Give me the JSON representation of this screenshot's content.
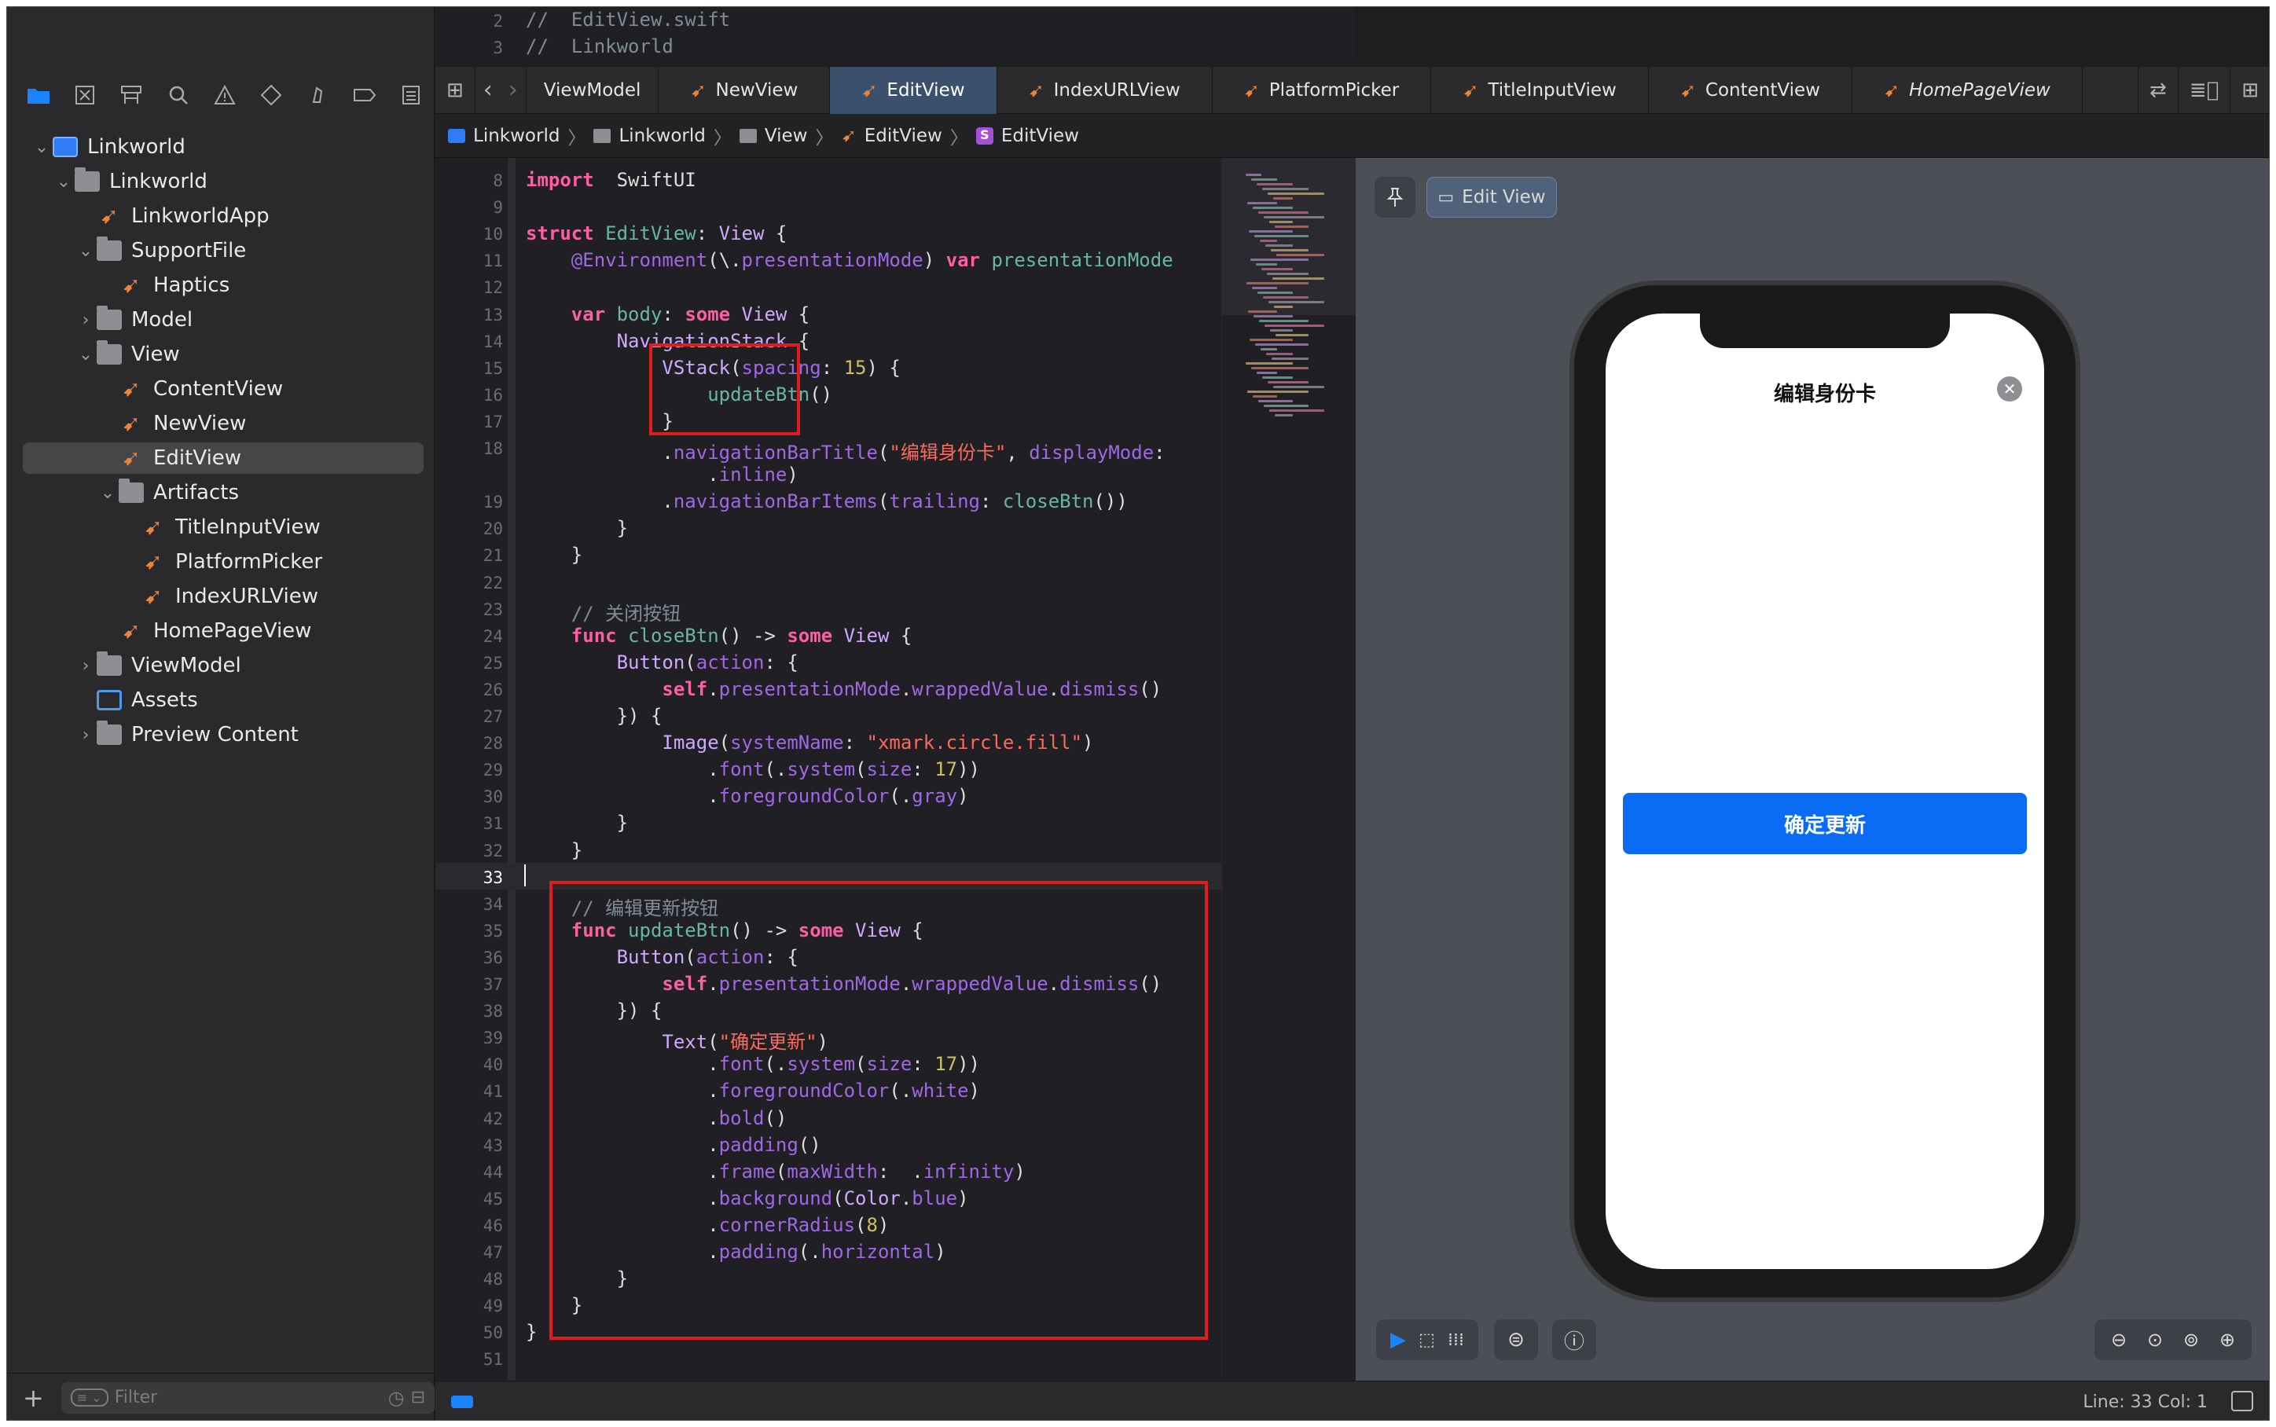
{
  "sidebar": {
    "tree": [
      {
        "label": "Linkworld",
        "icon": "project-icon",
        "indent": 0,
        "chevron": "expanded"
      },
      {
        "label": "Linkworld",
        "icon": "folder-icon",
        "indent": 1,
        "chevron": "expanded"
      },
      {
        "label": "LinkworldApp",
        "icon": "swift-icon",
        "indent": 2,
        "chevron": "none"
      },
      {
        "label": "SupportFile",
        "icon": "folder-icon",
        "indent": 2,
        "chevron": "expanded"
      },
      {
        "label": "Haptics",
        "icon": "swift-icon",
        "indent": 3,
        "chevron": "none"
      },
      {
        "label": "Model",
        "icon": "folder-icon",
        "indent": 2,
        "chevron": "collapsed"
      },
      {
        "label": "View",
        "icon": "folder-icon",
        "indent": 2,
        "chevron": "expanded"
      },
      {
        "label": "ContentView",
        "icon": "swift-icon",
        "indent": 3,
        "chevron": "none"
      },
      {
        "label": "NewView",
        "icon": "swift-icon",
        "indent": 3,
        "chevron": "none"
      },
      {
        "label": "EditView",
        "icon": "swift-icon",
        "indent": 3,
        "chevron": "none",
        "selected": true
      },
      {
        "label": "Artifacts",
        "icon": "folder-icon",
        "indent": 3,
        "chevron": "expanded"
      },
      {
        "label": "TitleInputView",
        "icon": "swift-icon",
        "indent": 4,
        "chevron": "none"
      },
      {
        "label": "PlatformPicker",
        "icon": "swift-icon",
        "indent": 4,
        "chevron": "none"
      },
      {
        "label": "IndexURLView",
        "icon": "swift-icon",
        "indent": 4,
        "chevron": "none"
      },
      {
        "label": "HomePageView",
        "icon": "swift-icon",
        "indent": 3,
        "chevron": "none"
      },
      {
        "label": "ViewModel",
        "icon": "folder-icon",
        "indent": 2,
        "chevron": "collapsed"
      },
      {
        "label": "Assets",
        "icon": "assets-icon",
        "indent": 2,
        "chevron": "none"
      },
      {
        "label": "Preview Content",
        "icon": "folder-icon",
        "indent": 2,
        "chevron": "collapsed"
      }
    ],
    "filter_placeholder": "Filter"
  },
  "top_code": [
    {
      "n": "2",
      "text": "//  EditView.swift"
    },
    {
      "n": "3",
      "text": "//  Linkworld"
    }
  ],
  "tabs": [
    {
      "label": "ViewModel",
      "swift": false
    },
    {
      "label": "NewView",
      "swift": true
    },
    {
      "label": "EditView",
      "swift": true,
      "active": true
    },
    {
      "label": "IndexURLView",
      "swift": true
    },
    {
      "label": "PlatformPicker",
      "swift": true
    },
    {
      "label": "TitleInputView",
      "swift": true
    },
    {
      "label": "ContentView",
      "swift": true
    },
    {
      "label": "HomePageView",
      "swift": true,
      "italic": true
    }
  ],
  "breadcrumbs": [
    "Linkworld",
    "Linkworld",
    "View",
    "EditView",
    "EditView"
  ],
  "code": [
    {
      "n": "8",
      "t": [
        [
          "kw",
          "import"
        ],
        [
          "",
          "  SwiftUI"
        ]
      ]
    },
    {
      "n": "9",
      "t": []
    },
    {
      "n": "10",
      "t": [
        [
          "kw",
          "struct"
        ],
        [
          "fn",
          " EditView"
        ],
        [
          "",
          ": "
        ],
        [
          "ty",
          "View"
        ],
        [
          "",
          " {"
        ]
      ]
    },
    {
      "n": "11",
      "t": [
        [
          "",
          "    "
        ],
        [
          "at",
          "@Environment"
        ],
        [
          "",
          "(\\."
        ],
        [
          "pr",
          "presentationMode"
        ],
        [
          "",
          ") "
        ],
        [
          "kw",
          "var"
        ],
        [
          "fn",
          " presentationMode"
        ]
      ]
    },
    {
      "n": "12",
      "t": []
    },
    {
      "n": "13",
      "t": [
        [
          "",
          "    "
        ],
        [
          "kw",
          "var"
        ],
        [
          "fn",
          " body"
        ],
        [
          "",
          ": "
        ],
        [
          "kw",
          "some"
        ],
        [
          "ty",
          " View"
        ],
        [
          "",
          " {"
        ]
      ]
    },
    {
      "n": "14",
      "t": [
        [
          "",
          "        "
        ],
        [
          "ty",
          "NavigationStack"
        ],
        [
          "",
          " {"
        ]
      ]
    },
    {
      "n": "15",
      "t": [
        [
          "",
          "            "
        ],
        [
          "ty",
          "VStack"
        ],
        [
          "",
          "("
        ],
        [
          "pr",
          "spacing"
        ],
        [
          "",
          ": "
        ],
        [
          "nu",
          "15"
        ],
        [
          "",
          ") {"
        ]
      ]
    },
    {
      "n": "16",
      "t": [
        [
          "",
          "                "
        ],
        [
          "fn",
          "updateBtn"
        ],
        [
          "",
          "()"
        ]
      ]
    },
    {
      "n": "17",
      "t": [
        [
          "",
          "            }"
        ]
      ]
    },
    {
      "n": "18",
      "t": [
        [
          "",
          "            ."
        ],
        [
          "pr",
          "navigationBarTitle"
        ],
        [
          "",
          "("
        ],
        [
          "st",
          "\"编辑身份卡\""
        ],
        [
          "",
          ", "
        ],
        [
          "pr",
          "displayMode"
        ],
        [
          "",
          ":"
        ]
      ]
    },
    {
      "n": "",
      "t": [
        [
          "",
          "                ."
        ],
        [
          "pr",
          "inline"
        ],
        [
          "",
          ")"
        ]
      ]
    },
    {
      "n": "19",
      "t": [
        [
          "",
          "            ."
        ],
        [
          "pr",
          "navigationBarItems"
        ],
        [
          "",
          "("
        ],
        [
          "pr",
          "trailing"
        ],
        [
          "",
          ": "
        ],
        [
          "fn",
          "closeBtn"
        ],
        [
          "",
          "())"
        ]
      ]
    },
    {
      "n": "20",
      "t": [
        [
          "",
          "        }"
        ]
      ]
    },
    {
      "n": "21",
      "t": [
        [
          "",
          "    }"
        ]
      ]
    },
    {
      "n": "22",
      "t": []
    },
    {
      "n": "23",
      "t": [
        [
          "cm",
          "    // 关闭按钮"
        ]
      ]
    },
    {
      "n": "24",
      "t": [
        [
          "",
          "    "
        ],
        [
          "kw",
          "func"
        ],
        [
          "fn",
          " closeBtn"
        ],
        [
          "",
          "() -> "
        ],
        [
          "kw",
          "some"
        ],
        [
          "ty",
          " View"
        ],
        [
          "",
          " {"
        ]
      ]
    },
    {
      "n": "25",
      "t": [
        [
          "",
          "        "
        ],
        [
          "ty",
          "Button"
        ],
        [
          "",
          "("
        ],
        [
          "pr",
          "action"
        ],
        [
          "",
          ": {"
        ]
      ]
    },
    {
      "n": "26",
      "t": [
        [
          "",
          "            "
        ],
        [
          "kw",
          "self"
        ],
        [
          "",
          "."
        ],
        [
          "pr",
          "presentationMode"
        ],
        [
          "",
          "."
        ],
        [
          "pr",
          "wrappedValue"
        ],
        [
          "",
          "."
        ],
        [
          "pr",
          "dismiss"
        ],
        [
          "",
          "()"
        ]
      ]
    },
    {
      "n": "27",
      "t": [
        [
          "",
          "        }) {"
        ]
      ]
    },
    {
      "n": "28",
      "t": [
        [
          "",
          "            "
        ],
        [
          "ty",
          "Image"
        ],
        [
          "",
          "("
        ],
        [
          "pr",
          "systemName"
        ],
        [
          "",
          ": "
        ],
        [
          "st",
          "\"xmark.circle.fill\""
        ],
        [
          "",
          ")"
        ]
      ]
    },
    {
      "n": "29",
      "t": [
        [
          "",
          "                ."
        ],
        [
          "pr",
          "font"
        ],
        [
          "",
          "(."
        ],
        [
          "pr",
          "system"
        ],
        [
          "",
          "("
        ],
        [
          "pr",
          "size"
        ],
        [
          "",
          ": "
        ],
        [
          "nu",
          "17"
        ],
        [
          "",
          "))"
        ]
      ]
    },
    {
      "n": "30",
      "t": [
        [
          "",
          "                ."
        ],
        [
          "pr",
          "foregroundColor"
        ],
        [
          "",
          "(."
        ],
        [
          "pr",
          "gray"
        ],
        [
          "",
          ")"
        ]
      ]
    },
    {
      "n": "31",
      "t": [
        [
          "",
          "        }"
        ]
      ]
    },
    {
      "n": "32",
      "t": [
        [
          "",
          "    }"
        ]
      ]
    },
    {
      "n": "33",
      "t": [],
      "current": true
    },
    {
      "n": "34",
      "t": [
        [
          "cm",
          "    // 编辑更新按钮"
        ]
      ]
    },
    {
      "n": "35",
      "t": [
        [
          "",
          "    "
        ],
        [
          "kw",
          "func"
        ],
        [
          "fn",
          " updateBtn"
        ],
        [
          "",
          "() -> "
        ],
        [
          "kw",
          "some"
        ],
        [
          "ty",
          " View"
        ],
        [
          "",
          " {"
        ]
      ]
    },
    {
      "n": "36",
      "t": [
        [
          "",
          "        "
        ],
        [
          "ty",
          "Button"
        ],
        [
          "",
          "("
        ],
        [
          "pr",
          "action"
        ],
        [
          "",
          ": {"
        ]
      ]
    },
    {
      "n": "37",
      "t": [
        [
          "",
          "            "
        ],
        [
          "kw",
          "self"
        ],
        [
          "",
          "."
        ],
        [
          "pr",
          "presentationMode"
        ],
        [
          "",
          "."
        ],
        [
          "pr",
          "wrappedValue"
        ],
        [
          "",
          "."
        ],
        [
          "pr",
          "dismiss"
        ],
        [
          "",
          "()"
        ]
      ]
    },
    {
      "n": "38",
      "t": [
        [
          "",
          "        }) {"
        ]
      ]
    },
    {
      "n": "39",
      "t": [
        [
          "",
          "            "
        ],
        [
          "ty",
          "Text"
        ],
        [
          "",
          "("
        ],
        [
          "st",
          "\"确定更新\""
        ],
        [
          "",
          ")"
        ]
      ]
    },
    {
      "n": "40",
      "t": [
        [
          "",
          "                ."
        ],
        [
          "pr",
          "font"
        ],
        [
          "",
          "(."
        ],
        [
          "pr",
          "system"
        ],
        [
          "",
          "("
        ],
        [
          "pr",
          "size"
        ],
        [
          "",
          ": "
        ],
        [
          "nu",
          "17"
        ],
        [
          "",
          "))"
        ]
      ]
    },
    {
      "n": "41",
      "t": [
        [
          "",
          "                ."
        ],
        [
          "pr",
          "foregroundColor"
        ],
        [
          "",
          "(."
        ],
        [
          "pr",
          "white"
        ],
        [
          "",
          ")"
        ]
      ]
    },
    {
      "n": "42",
      "t": [
        [
          "",
          "                ."
        ],
        [
          "pr",
          "bold"
        ],
        [
          "",
          "()"
        ]
      ]
    },
    {
      "n": "43",
      "t": [
        [
          "",
          "                ."
        ],
        [
          "pr",
          "padding"
        ],
        [
          "",
          "()"
        ]
      ]
    },
    {
      "n": "44",
      "t": [
        [
          "",
          "                ."
        ],
        [
          "pr",
          "frame"
        ],
        [
          "",
          "("
        ],
        [
          "pr",
          "maxWidth"
        ],
        [
          "",
          ":  ."
        ],
        [
          "pr",
          "infinity"
        ],
        [
          "",
          ")"
        ]
      ]
    },
    {
      "n": "45",
      "t": [
        [
          "",
          "                ."
        ],
        [
          "pr",
          "background"
        ],
        [
          "",
          "("
        ],
        [
          "ty",
          "Color"
        ],
        [
          "",
          "."
        ],
        [
          "pr",
          "blue"
        ],
        [
          "",
          ")"
        ]
      ]
    },
    {
      "n": "46",
      "t": [
        [
          "",
          "                ."
        ],
        [
          "pr",
          "cornerRadius"
        ],
        [
          "",
          "("
        ],
        [
          "nu",
          "8"
        ],
        [
          "",
          ")"
        ]
      ]
    },
    {
      "n": "47",
      "t": [
        [
          "",
          "                ."
        ],
        [
          "pr",
          "padding"
        ],
        [
          "",
          "(."
        ],
        [
          "pr",
          "horizontal"
        ],
        [
          "",
          ")"
        ]
      ]
    },
    {
      "n": "48",
      "t": [
        [
          "",
          "        }"
        ]
      ]
    },
    {
      "n": "49",
      "t": [
        [
          "",
          "    }"
        ]
      ]
    },
    {
      "n": "50",
      "t": [
        [
          "",
          "}"
        ]
      ]
    },
    {
      "n": "51",
      "t": []
    }
  ],
  "preview": {
    "pin_icon": "pin-icon",
    "edit_view_label": "Edit View",
    "nav_title": "编辑身份卡",
    "close_glyph": "✕",
    "update_button": "确定更新"
  },
  "status_bar": {
    "line_col": "Line: 33  Col: 1"
  },
  "colors": {
    "accent": "#1a84ff",
    "swift_orange": "#f0823a",
    "annotation_red": "#e21c1c",
    "preview_button_blue": "#0a6cf5"
  }
}
